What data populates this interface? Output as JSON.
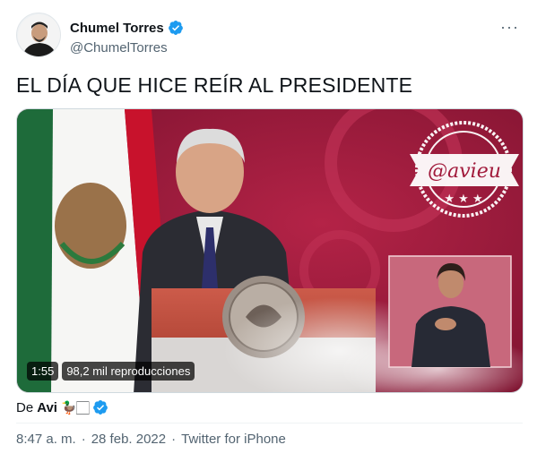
{
  "author": {
    "display_name": "Chumel Torres",
    "handle": "@ChumelTorres",
    "verified_icon": "verified-badge-icon",
    "avatar_icon": "avatar"
  },
  "more_label": "···",
  "tweet": {
    "text": "EL DÍA QUE HICE REÍR AL PRESIDENTE"
  },
  "video": {
    "duration": "1:55",
    "views": "98,2 mil reproducciones",
    "watermark_text": "@avieu"
  },
  "source": {
    "prefix": "De",
    "user": "Avi",
    "emoji": "🦆🏻"
  },
  "meta": {
    "time": "8:47 a. m.",
    "separator1": "·",
    "date": "28 feb. 2022",
    "separator2": "·",
    "client": "Twitter for iPhone"
  },
  "colors": {
    "accent": "#1d9bf0",
    "text_primary": "#0f1419",
    "text_secondary": "#536471",
    "backdrop": "#a21a3b"
  }
}
